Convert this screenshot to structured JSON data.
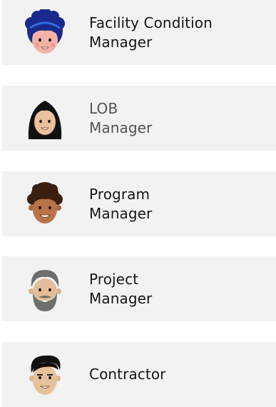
{
  "roles": [
    {
      "id": "facility",
      "line1": "Facility Condition",
      "line2": "Manager",
      "avatar": "woman-blue-hair-avatar-icon"
    },
    {
      "id": "lob",
      "line1": "LOB",
      "line2": "Manager",
      "avatar": "woman-black-hair-avatar-icon"
    },
    {
      "id": "program",
      "line1": "Program",
      "line2": "Manager",
      "avatar": "man-curly-hair-avatar-icon"
    },
    {
      "id": "project",
      "line1": "Project",
      "line2": "Manager",
      "avatar": "man-gray-beard-avatar-icon"
    },
    {
      "id": "contractor",
      "line1": "Contractor",
      "line2": "",
      "avatar": "man-black-hair-avatar-icon"
    }
  ],
  "colors": {
    "card_bg": "#f2f2f2",
    "text": "#161616",
    "text_secondary": "#525252"
  }
}
